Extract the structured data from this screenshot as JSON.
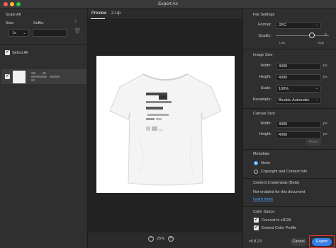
{
  "window": {
    "title": "Export As"
  },
  "left_panel": {
    "scale_all_label": "Scale All",
    "size_label": "Size:",
    "suffix_label": "Suffix:",
    "size_value": "1x",
    "select_all_label": "Select All",
    "add_icon": "plus-icon"
  },
  "center": {
    "tabs": [
      {
        "label": "Preview"
      },
      {
        "label": "2-Up"
      }
    ],
    "active_tab": "Preview",
    "zoom": {
      "value": "25%",
      "minus": "−",
      "plus": "+"
    }
  },
  "file_settings": {
    "title": "File Settings",
    "format_label": "Format:",
    "format_value": "JPG",
    "quality_label": "Quality:",
    "quality_value": 6,
    "quality_min_label": "Low",
    "quality_max_label": "High"
  },
  "image_size": {
    "title": "Image Size",
    "width_label": "Width:",
    "width_value": "4000",
    "height_label": "Height:",
    "height_value": "4000",
    "unit": "px",
    "scale_label": "Scale:",
    "scale_value": "100%",
    "resample_label": "Resample:",
    "resample_value": "Bicubic Automatic"
  },
  "canvas_size": {
    "title": "Canvas Size",
    "width_label": "Width:",
    "width_value": "4000",
    "height_label": "Height:",
    "height_value": "4000",
    "unit": "px",
    "reset_label": "Reset"
  },
  "metadata": {
    "title": "Metadata",
    "option_none": "None",
    "option_copyright": "Copyright and Contact Info",
    "selected": "None"
  },
  "content_credentials": {
    "title": "Content Credentials (Beta)",
    "status": "Not enabled for this document",
    "learn_more": "Learn more"
  },
  "color_space": {
    "title": "Color Space",
    "convert_srgb": "Convert to sRGB",
    "embed_profile": "Embed Color Profile"
  },
  "footer": {
    "version": "v5.8.23",
    "cancel": "Cancel",
    "export": "Export"
  },
  "colors": {
    "accent": "#3b7de8",
    "highlight_outline": "#e33333",
    "background": "#2b2b2b"
  }
}
